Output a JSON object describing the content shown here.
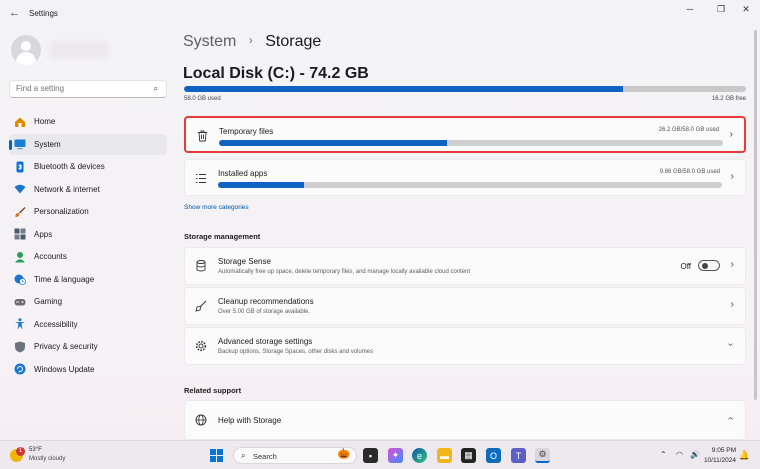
{
  "window": {
    "back_icon": "back-arrow-icon",
    "title": "Settings",
    "controls": [
      "minimize-icon",
      "restore-icon",
      "close-icon"
    ]
  },
  "search": {
    "placeholder": "Find a setting",
    "icon": "search-icon"
  },
  "nav": {
    "items": [
      {
        "label": "Home",
        "icon": "home-icon",
        "color": "#e08a00"
      },
      {
        "label": "System",
        "icon": "system-icon",
        "color": "#1a7fd4",
        "active": true
      },
      {
        "label": "Bluetooth & devices",
        "icon": "bluetooth-icon",
        "color": "#0a6fd6"
      },
      {
        "label": "Network & internet",
        "icon": "wifi-icon",
        "color": "#1b76d1"
      },
      {
        "label": "Personalization",
        "icon": "brush-icon",
        "color": "#d0762b"
      },
      {
        "label": "Apps",
        "icon": "apps-icon",
        "color": "#4b5b6e"
      },
      {
        "label": "Accounts",
        "icon": "accounts-icon",
        "color": "#2a9d5b"
      },
      {
        "label": "Time & language",
        "icon": "globe-clock-icon",
        "color": "#1b76d1"
      },
      {
        "label": "Gaming",
        "icon": "gamepad-icon",
        "color": "#6b6b6b"
      },
      {
        "label": "Accessibility",
        "icon": "accessibility-icon",
        "color": "#1b76d1"
      },
      {
        "label": "Privacy & security",
        "icon": "shield-icon",
        "color": "#6b7280"
      },
      {
        "label": "Windows Update",
        "icon": "update-icon",
        "color": "#1b76d1"
      }
    ]
  },
  "header": {
    "parent": "System",
    "separator": "›",
    "current": "Storage"
  },
  "disk": {
    "title": "Local Disk (C:) - 74.2 GB",
    "used_label": "58.0 GB used",
    "free_label": "16.2 GB free",
    "used_fraction": 0.782
  },
  "categories": [
    {
      "name": "Temporary files",
      "usage": "26.2 GB/58.0 GB used",
      "fraction": 0.452,
      "icon": "trash-icon"
    },
    {
      "name": "Installed apps",
      "usage": "9.86 GB/58.0 GB used",
      "fraction": 0.17,
      "icon": "list-icon"
    }
  ],
  "show_more": "Show more categories",
  "management": {
    "heading": "Storage management",
    "items": [
      {
        "name": "Storage Sense",
        "desc": "Automatically free up space, delete temporary files, and manage locally available cloud content",
        "icon": "storage-icon",
        "toggle_label": "Off"
      },
      {
        "name": "Cleanup recommendations",
        "desc": "Over 5.00 GB of storage available.",
        "icon": "broom-icon"
      },
      {
        "name": "Advanced storage settings",
        "desc": "Backup options, Storage Spaces, other disks and volumes",
        "icon": "gear-icon"
      }
    ]
  },
  "support": {
    "heading": "Related support",
    "items": [
      {
        "name": "Help with Storage",
        "icon": "globe-icon"
      }
    ]
  },
  "taskbar": {
    "weather": {
      "badge": "1",
      "temp": "53°F",
      "condition": "Mostly cloudy"
    },
    "search_label": "Search",
    "time": "9:05 PM",
    "date": "10/11/2024"
  }
}
